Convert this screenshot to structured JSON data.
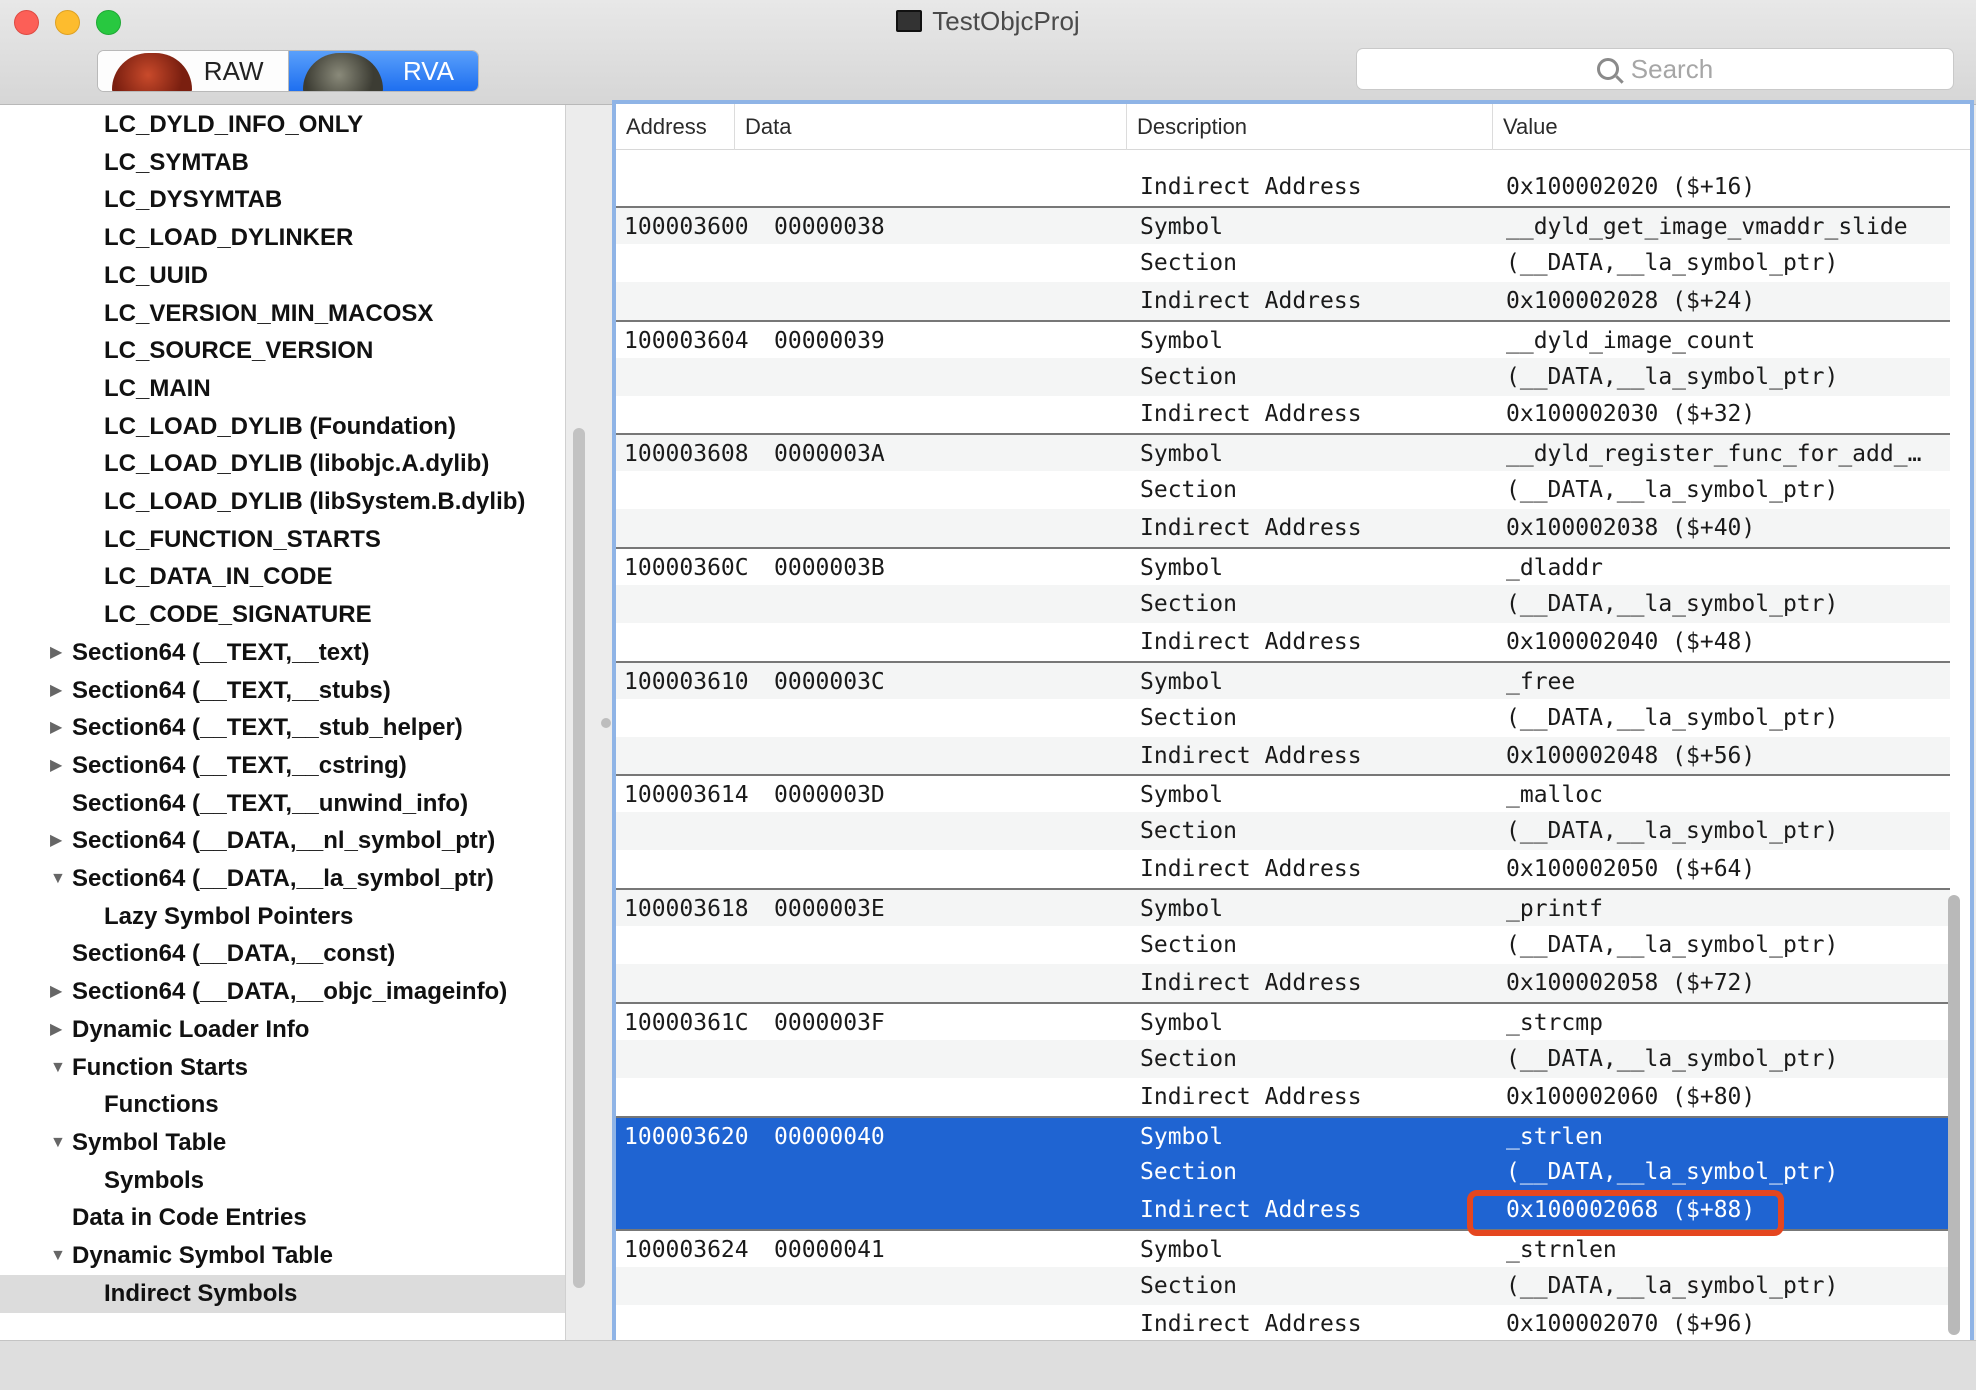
{
  "window": {
    "title": "TestObjcProj"
  },
  "toolbar": {
    "segments": [
      {
        "label": "RAW",
        "icon": "raw-thumbnail-icon",
        "active": false
      },
      {
        "label": "RVA",
        "icon": "rva-thumbnail-icon",
        "active": true
      }
    ],
    "search": {
      "placeholder": "Search",
      "value": ""
    }
  },
  "sidebar": {
    "items": [
      {
        "label": "LC_DYLD_INFO_ONLY",
        "indent": 2,
        "disclosure": ""
      },
      {
        "label": "LC_SYMTAB",
        "indent": 2,
        "disclosure": ""
      },
      {
        "label": "LC_DYSYMTAB",
        "indent": 2,
        "disclosure": ""
      },
      {
        "label": "LC_LOAD_DYLINKER",
        "indent": 2,
        "disclosure": ""
      },
      {
        "label": "LC_UUID",
        "indent": 2,
        "disclosure": ""
      },
      {
        "label": "LC_VERSION_MIN_MACOSX",
        "indent": 2,
        "disclosure": ""
      },
      {
        "label": "LC_SOURCE_VERSION",
        "indent": 2,
        "disclosure": ""
      },
      {
        "label": "LC_MAIN",
        "indent": 2,
        "disclosure": ""
      },
      {
        "label": "LC_LOAD_DYLIB (Foundation)",
        "indent": 2,
        "disclosure": ""
      },
      {
        "label": "LC_LOAD_DYLIB (libobjc.A.dylib)",
        "indent": 2,
        "disclosure": ""
      },
      {
        "label": "LC_LOAD_DYLIB (libSystem.B.dylib)",
        "indent": 2,
        "disclosure": ""
      },
      {
        "label": "LC_FUNCTION_STARTS",
        "indent": 2,
        "disclosure": ""
      },
      {
        "label": "LC_DATA_IN_CODE",
        "indent": 2,
        "disclosure": ""
      },
      {
        "label": "LC_CODE_SIGNATURE",
        "indent": 2,
        "disclosure": ""
      },
      {
        "label": "Section64 (__TEXT,__text)",
        "indent": 1,
        "disclosure": "▶"
      },
      {
        "label": "Section64 (__TEXT,__stubs)",
        "indent": 1,
        "disclosure": "▶"
      },
      {
        "label": "Section64 (__TEXT,__stub_helper)",
        "indent": 1,
        "disclosure": "▶"
      },
      {
        "label": "Section64 (__TEXT,__cstring)",
        "indent": 1,
        "disclosure": "▶"
      },
      {
        "label": "Section64 (__TEXT,__unwind_info)",
        "indent": 1,
        "disclosure": ""
      },
      {
        "label": "Section64 (__DATA,__nl_symbol_ptr)",
        "indent": 1,
        "disclosure": "▶"
      },
      {
        "label": "Section64 (__DATA,__la_symbol_ptr)",
        "indent": 1,
        "disclosure": "▼"
      },
      {
        "label": "Lazy Symbol Pointers",
        "indent": 2,
        "disclosure": ""
      },
      {
        "label": "Section64 (__DATA,__const)",
        "indent": 1,
        "disclosure": ""
      },
      {
        "label": "Section64 (__DATA,__objc_imageinfo)",
        "indent": 1,
        "disclosure": "▶"
      },
      {
        "label": "Dynamic Loader Info",
        "indent": 1,
        "disclosure": "▶"
      },
      {
        "label": "Function Starts",
        "indent": 1,
        "disclosure": "▼"
      },
      {
        "label": "Functions",
        "indent": 2,
        "disclosure": ""
      },
      {
        "label": "Symbol Table",
        "indent": 1,
        "disclosure": "▼"
      },
      {
        "label": "Symbols",
        "indent": 2,
        "disclosure": ""
      },
      {
        "label": "Data in Code Entries",
        "indent": 1,
        "disclosure": ""
      },
      {
        "label": "Dynamic Symbol Table",
        "indent": 1,
        "disclosure": "▼"
      },
      {
        "label": "Indirect Symbols",
        "indent": 2,
        "disclosure": "",
        "selected": true
      }
    ]
  },
  "table": {
    "columns": [
      "Address",
      "Data",
      "Description",
      "Value"
    ],
    "rows": [
      {
        "address": "",
        "data": "",
        "description": "Indirect Address",
        "value": "0x100002020 ($+16)"
      },
      {
        "address": "100003600",
        "data": "00000038",
        "description": "Symbol",
        "value": "__dyld_get_image_vmaddr_slide"
      },
      {
        "address": "",
        "data": "",
        "description": "Section",
        "value": "(__DATA,__la_symbol_ptr)"
      },
      {
        "address": "",
        "data": "",
        "description": "Indirect Address",
        "value": "0x100002028 ($+24)"
      },
      {
        "address": "100003604",
        "data": "00000039",
        "description": "Symbol",
        "value": "__dyld_image_count"
      },
      {
        "address": "",
        "data": "",
        "description": "Section",
        "value": "(__DATA,__la_symbol_ptr)"
      },
      {
        "address": "",
        "data": "",
        "description": "Indirect Address",
        "value": "0x100002030 ($+32)"
      },
      {
        "address": "100003608",
        "data": "0000003A",
        "description": "Symbol",
        "value": "__dyld_register_func_for_add_…"
      },
      {
        "address": "",
        "data": "",
        "description": "Section",
        "value": "(__DATA,__la_symbol_ptr)"
      },
      {
        "address": "",
        "data": "",
        "description": "Indirect Address",
        "value": "0x100002038 ($+40)"
      },
      {
        "address": "10000360C",
        "data": "0000003B",
        "description": "Symbol",
        "value": "_dladdr"
      },
      {
        "address": "",
        "data": "",
        "description": "Section",
        "value": "(__DATA,__la_symbol_ptr)"
      },
      {
        "address": "",
        "data": "",
        "description": "Indirect Address",
        "value": "0x100002040 ($+48)"
      },
      {
        "address": "100003610",
        "data": "0000003C",
        "description": "Symbol",
        "value": "_free"
      },
      {
        "address": "",
        "data": "",
        "description": "Section",
        "value": "(__DATA,__la_symbol_ptr)"
      },
      {
        "address": "",
        "data": "",
        "description": "Indirect Address",
        "value": "0x100002048 ($+56)"
      },
      {
        "address": "100003614",
        "data": "0000003D",
        "description": "Symbol",
        "value": "_malloc"
      },
      {
        "address": "",
        "data": "",
        "description": "Section",
        "value": "(__DATA,__la_symbol_ptr)"
      },
      {
        "address": "",
        "data": "",
        "description": "Indirect Address",
        "value": "0x100002050 ($+64)"
      },
      {
        "address": "100003618",
        "data": "0000003E",
        "description": "Symbol",
        "value": "_printf"
      },
      {
        "address": "",
        "data": "",
        "description": "Section",
        "value": "(__DATA,__la_symbol_ptr)"
      },
      {
        "address": "",
        "data": "",
        "description": "Indirect Address",
        "value": "0x100002058 ($+72)"
      },
      {
        "address": "10000361C",
        "data": "0000003F",
        "description": "Symbol",
        "value": "_strcmp"
      },
      {
        "address": "",
        "data": "",
        "description": "Section",
        "value": "(__DATA,__la_symbol_ptr)"
      },
      {
        "address": "",
        "data": "",
        "description": "Indirect Address",
        "value": "0x100002060 ($+80)"
      },
      {
        "address": "100003620",
        "data": "00000040",
        "description": "Symbol",
        "value": "_strlen",
        "selected": true
      },
      {
        "address": "",
        "data": "",
        "description": "Section",
        "value": "(__DATA,__la_symbol_ptr)",
        "selected": true
      },
      {
        "address": "",
        "data": "",
        "description": "Indirect Address",
        "value": "0x100002068 ($+88)",
        "selected": true,
        "highlighted": true
      },
      {
        "address": "100003624",
        "data": "00000041",
        "description": "Symbol",
        "value": "_strnlen"
      },
      {
        "address": "",
        "data": "",
        "description": "Section",
        "value": "(__DATA,__la_symbol_ptr)"
      },
      {
        "address": "",
        "data": "",
        "description": "Indirect Address",
        "value": "0x100002070 ($+96)"
      }
    ]
  },
  "colors": {
    "selection": "#1f64d2",
    "highlight_ring": "#e5461f",
    "focus_ring": "#8fb4e6"
  }
}
